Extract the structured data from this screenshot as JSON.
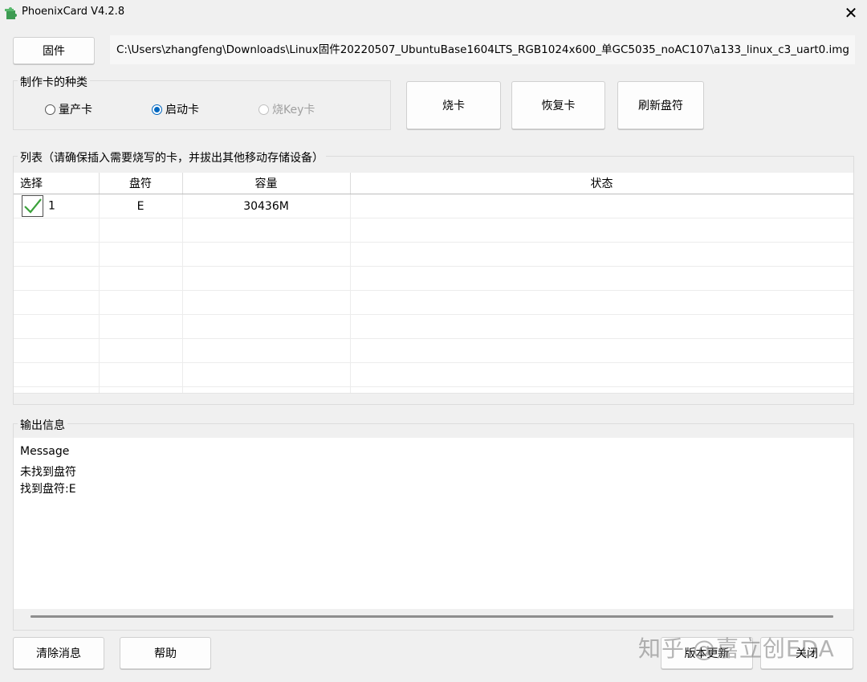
{
  "window": {
    "title": "PhoenixCard V4.2.8",
    "close_glyph": "✕",
    "app_icon": "puzzle-icon"
  },
  "firmware": {
    "button_label": "固件",
    "path": "C:\\Users\\zhangfeng\\Downloads\\Linux固件20220507_UbuntuBase1604LTS_RGB1024x600_单GC5035_noAC107\\a133_linux_c3_uart0.img"
  },
  "card_type": {
    "group_label": "制作卡的种类",
    "options": [
      {
        "label": "量产卡",
        "checked": false,
        "enabled": true
      },
      {
        "label": "启动卡",
        "checked": true,
        "enabled": true
      },
      {
        "label": "烧Key卡",
        "checked": false,
        "enabled": false
      }
    ]
  },
  "actions": {
    "burn": "烧卡",
    "restore": "恢复卡",
    "refresh": "刷新盘符"
  },
  "list": {
    "group_label": "列表（请确保插入需要烧写的卡，并拔出其他移动存储设备）",
    "columns": [
      "选择",
      "盘符",
      "容量",
      "状态"
    ],
    "rows": [
      {
        "checked": true,
        "index": "1",
        "drive": "E",
        "capacity": "30436M",
        "status": ""
      }
    ]
  },
  "output": {
    "group_label": "输出信息",
    "header": "Message",
    "lines": [
      "未找到盘符",
      "找到盘符:E"
    ]
  },
  "bottom": {
    "clear": "清除消息",
    "help": "帮助",
    "update": "版本更新",
    "close": "关闭"
  },
  "watermark": "知乎 @嘉立创EDA",
  "colors": {
    "check_green": "#3aa13a",
    "radio_blue": "#0067c0"
  }
}
